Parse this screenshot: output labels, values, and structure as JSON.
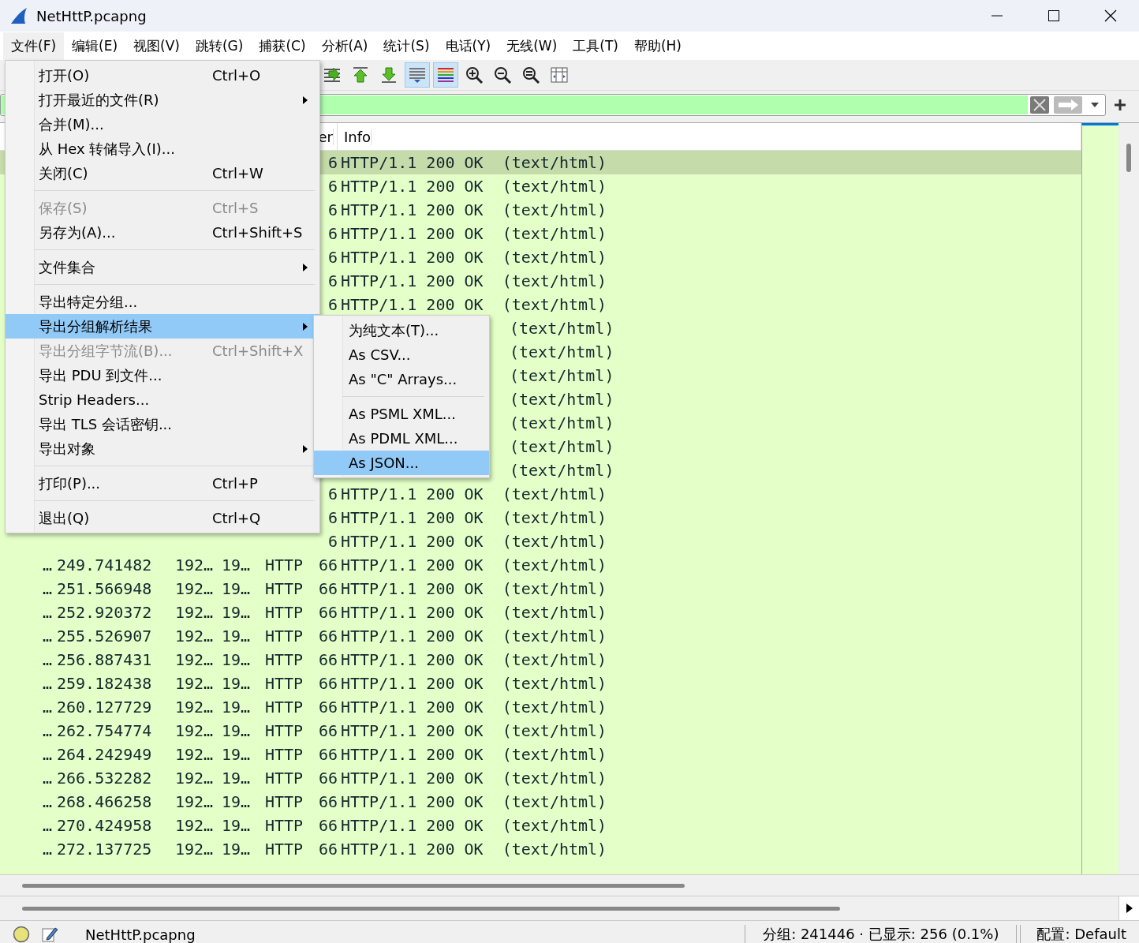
{
  "window": {
    "title": "NetHttP.pcapng"
  },
  "menubar": [
    {
      "label": "文件(F)",
      "selected": true
    },
    {
      "label": "编辑(E)",
      "selected": false
    },
    {
      "label": "视图(V)",
      "selected": false
    },
    {
      "label": "跳转(G)",
      "selected": false
    },
    {
      "label": "捕获(C)",
      "selected": false
    },
    {
      "label": "分析(A)",
      "selected": false
    },
    {
      "label": "统计(S)",
      "selected": false
    },
    {
      "label": "电话(Y)",
      "selected": false
    },
    {
      "label": "无线(W)",
      "selected": false
    },
    {
      "label": "工具(T)",
      "selected": false
    },
    {
      "label": "帮助(H)",
      "selected": false
    }
  ],
  "toolbar": [
    {
      "kind": "goto",
      "pressed": false
    },
    {
      "kind": "first",
      "pressed": false
    },
    {
      "kind": "last",
      "pressed": false
    },
    {
      "kind": "autoscroll",
      "pressed": true
    },
    {
      "kind": "colorize",
      "pressed": true
    },
    {
      "kind": "zoomin",
      "pressed": false
    },
    {
      "kind": "zoomout",
      "pressed": false
    },
    {
      "kind": "zoomreset",
      "pressed": false
    },
    {
      "kind": "resize",
      "pressed": false
    }
  ],
  "filter": {
    "valid": true
  },
  "packet_list": {
    "columns": [
      {
        "label": "er"
      },
      {
        "label": "Info"
      }
    ],
    "rows": [
      {
        "kind": "covered",
        "selected": true,
        "length": "6",
        "info": "HTTP/1.1 200 OK  (text/html)"
      },
      {
        "kind": "covered",
        "selected": false,
        "length": "6",
        "info": "HTTP/1.1 200 OK  (text/html)"
      },
      {
        "kind": "covered",
        "selected": false,
        "length": "6",
        "info": "HTTP/1.1 200 OK  (text/html)"
      },
      {
        "kind": "covered",
        "selected": false,
        "length": "6",
        "info": "HTTP/1.1 200 OK  (text/html)"
      },
      {
        "kind": "covered",
        "selected": false,
        "length": "6",
        "info": "HTTP/1.1 200 OK  (text/html)"
      },
      {
        "kind": "covered",
        "selected": false,
        "length": "6",
        "info": "HTTP/1.1 200 OK  (text/html)"
      },
      {
        "kind": "covered",
        "selected": false,
        "length": "6",
        "info": "HTTP/1.1 200 OK  (text/html)"
      },
      {
        "kind": "tail",
        "selected": false,
        "info": "(text/html)"
      },
      {
        "kind": "tail",
        "selected": false,
        "info": "(text/html)"
      },
      {
        "kind": "tail",
        "selected": false,
        "info": "(text/html)"
      },
      {
        "kind": "tail",
        "selected": false,
        "info": "(text/html)"
      },
      {
        "kind": "tail",
        "selected": false,
        "info": "(text/html)"
      },
      {
        "kind": "tail",
        "selected": false,
        "info": "(text/html)"
      },
      {
        "kind": "tail",
        "selected": false,
        "info": "(text/html)"
      },
      {
        "kind": "covered",
        "selected": false,
        "length": "6",
        "info": "HTTP/1.1 200 OK  (text/html)"
      },
      {
        "kind": "covered",
        "selected": false,
        "length": "6",
        "info": "HTTP/1.1 200 OK  (text/html)"
      },
      {
        "kind": "covered",
        "selected": false,
        "length": "6",
        "info": "HTTP/1.1 200 OK  (text/html)"
      },
      {
        "kind": "full",
        "selected": false,
        "no": "…",
        "time": "249.741482",
        "source": "192…",
        "destination": "19…",
        "protocol": "HTTP",
        "length": "66",
        "info": "HTTP/1.1 200 OK  (text/html)"
      },
      {
        "kind": "full",
        "selected": false,
        "no": "…",
        "time": "251.566948",
        "source": "192…",
        "destination": "19…",
        "protocol": "HTTP",
        "length": "66",
        "info": "HTTP/1.1 200 OK  (text/html)"
      },
      {
        "kind": "full",
        "selected": false,
        "no": "…",
        "time": "252.920372",
        "source": "192…",
        "destination": "19…",
        "protocol": "HTTP",
        "length": "66",
        "info": "HTTP/1.1 200 OK  (text/html)"
      },
      {
        "kind": "full",
        "selected": false,
        "no": "…",
        "time": "255.526907",
        "source": "192…",
        "destination": "19…",
        "protocol": "HTTP",
        "length": "66",
        "info": "HTTP/1.1 200 OK  (text/html)"
      },
      {
        "kind": "full",
        "selected": false,
        "no": "…",
        "time": "256.887431",
        "source": "192…",
        "destination": "19…",
        "protocol": "HTTP",
        "length": "66",
        "info": "HTTP/1.1 200 OK  (text/html)"
      },
      {
        "kind": "full",
        "selected": false,
        "no": "…",
        "time": "259.182438",
        "source": "192…",
        "destination": "19…",
        "protocol": "HTTP",
        "length": "66",
        "info": "HTTP/1.1 200 OK  (text/html)"
      },
      {
        "kind": "full",
        "selected": false,
        "no": "…",
        "time": "260.127729",
        "source": "192…",
        "destination": "19…",
        "protocol": "HTTP",
        "length": "66",
        "info": "HTTP/1.1 200 OK  (text/html)"
      },
      {
        "kind": "full",
        "selected": false,
        "no": "…",
        "time": "262.754774",
        "source": "192…",
        "destination": "19…",
        "protocol": "HTTP",
        "length": "66",
        "info": "HTTP/1.1 200 OK  (text/html)"
      },
      {
        "kind": "full",
        "selected": false,
        "no": "…",
        "time": "264.242949",
        "source": "192…",
        "destination": "19…",
        "protocol": "HTTP",
        "length": "66",
        "info": "HTTP/1.1 200 OK  (text/html)"
      },
      {
        "kind": "full",
        "selected": false,
        "no": "…",
        "time": "266.532282",
        "source": "192…",
        "destination": "19…",
        "protocol": "HTTP",
        "length": "66",
        "info": "HTTP/1.1 200 OK  (text/html)"
      },
      {
        "kind": "full",
        "selected": false,
        "no": "…",
        "time": "268.466258",
        "source": "192…",
        "destination": "19…",
        "protocol": "HTTP",
        "length": "66",
        "info": "HTTP/1.1 200 OK  (text/html)"
      },
      {
        "kind": "full",
        "selected": false,
        "no": "…",
        "time": "270.424958",
        "source": "192…",
        "destination": "19…",
        "protocol": "HTTP",
        "length": "66",
        "info": "HTTP/1.1 200 OK  (text/html)"
      },
      {
        "kind": "full",
        "selected": false,
        "no": "…",
        "time": "272.137725",
        "source": "192…",
        "destination": "19…",
        "protocol": "HTTP",
        "length": "66",
        "info": "HTTP/1.1 200 OK  (text/html)"
      }
    ]
  },
  "file_menu": [
    {
      "kind": "item",
      "label": "打开(O)",
      "shortcut": "Ctrl+O",
      "disabled": false,
      "submenu": false,
      "selected": false
    },
    {
      "kind": "item",
      "label": "打开最近的文件(R)",
      "disabled": false,
      "submenu": true,
      "selected": false
    },
    {
      "kind": "item",
      "label": "合并(M)...",
      "disabled": false,
      "submenu": false,
      "selected": false
    },
    {
      "kind": "item",
      "label": "从 Hex 转储导入(I)...",
      "disabled": false,
      "submenu": false,
      "selected": false
    },
    {
      "kind": "item",
      "label": "关闭(C)",
      "shortcut": "Ctrl+W",
      "disabled": false,
      "submenu": false,
      "selected": false
    },
    {
      "kind": "separator"
    },
    {
      "kind": "item",
      "label": "保存(S)",
      "shortcut": "Ctrl+S",
      "disabled": true,
      "submenu": false,
      "selected": false
    },
    {
      "kind": "item",
      "label": "另存为(A)...",
      "shortcut": "Ctrl+Shift+S",
      "disabled": false,
      "submenu": false,
      "selected": false
    },
    {
      "kind": "separator"
    },
    {
      "kind": "item",
      "label": "文件集合",
      "disabled": false,
      "submenu": true,
      "selected": false
    },
    {
      "kind": "separator"
    },
    {
      "kind": "item",
      "label": "导出特定分组...",
      "disabled": false,
      "submenu": false,
      "selected": false
    },
    {
      "kind": "item",
      "label": "导出分组解析结果",
      "disabled": false,
      "submenu": true,
      "selected": true
    },
    {
      "kind": "item",
      "label": "导出分组字节流(B)...",
      "shortcut": "Ctrl+Shift+X",
      "disabled": true,
      "submenu": false,
      "selected": false
    },
    {
      "kind": "item",
      "label": "导出 PDU 到文件...",
      "disabled": false,
      "submenu": false,
      "selected": false
    },
    {
      "kind": "item",
      "label": "Strip Headers...",
      "disabled": false,
      "submenu": false,
      "selected": false
    },
    {
      "kind": "item",
      "label": "导出 TLS 会话密钥...",
      "disabled": false,
      "submenu": false,
      "selected": false
    },
    {
      "kind": "item",
      "label": "导出对象",
      "disabled": false,
      "submenu": true,
      "selected": false
    },
    {
      "kind": "separator"
    },
    {
      "kind": "item",
      "label": "打印(P)...",
      "shortcut": "Ctrl+P",
      "disabled": false,
      "submenu": false,
      "selected": false
    },
    {
      "kind": "separator"
    },
    {
      "kind": "item",
      "label": "退出(Q)",
      "shortcut": "Ctrl+Q",
      "disabled": false,
      "submenu": false,
      "selected": false
    }
  ],
  "export_submenu": [
    {
      "kind": "item",
      "label": "为纯文本(T)...",
      "disabled": false,
      "submenu": false,
      "selected": false
    },
    {
      "kind": "item",
      "label": "As CSV...",
      "disabled": false,
      "submenu": false,
      "selected": false
    },
    {
      "kind": "item",
      "label": "As \"C\" Arrays...",
      "disabled": false,
      "submenu": false,
      "selected": false
    },
    {
      "kind": "separator"
    },
    {
      "kind": "item",
      "label": "As PSML XML...",
      "disabled": false,
      "submenu": false,
      "selected": false
    },
    {
      "kind": "item",
      "label": "As PDML XML...",
      "disabled": false,
      "submenu": false,
      "selected": false
    },
    {
      "kind": "item",
      "label": "As JSON...",
      "disabled": false,
      "submenu": false,
      "selected": true
    }
  ],
  "status_bar": {
    "file": "NetHttP.pcapng",
    "packets": "分组: 241446 · 已显示: 256 (0.1%)",
    "profile": "配置:  Default"
  }
}
